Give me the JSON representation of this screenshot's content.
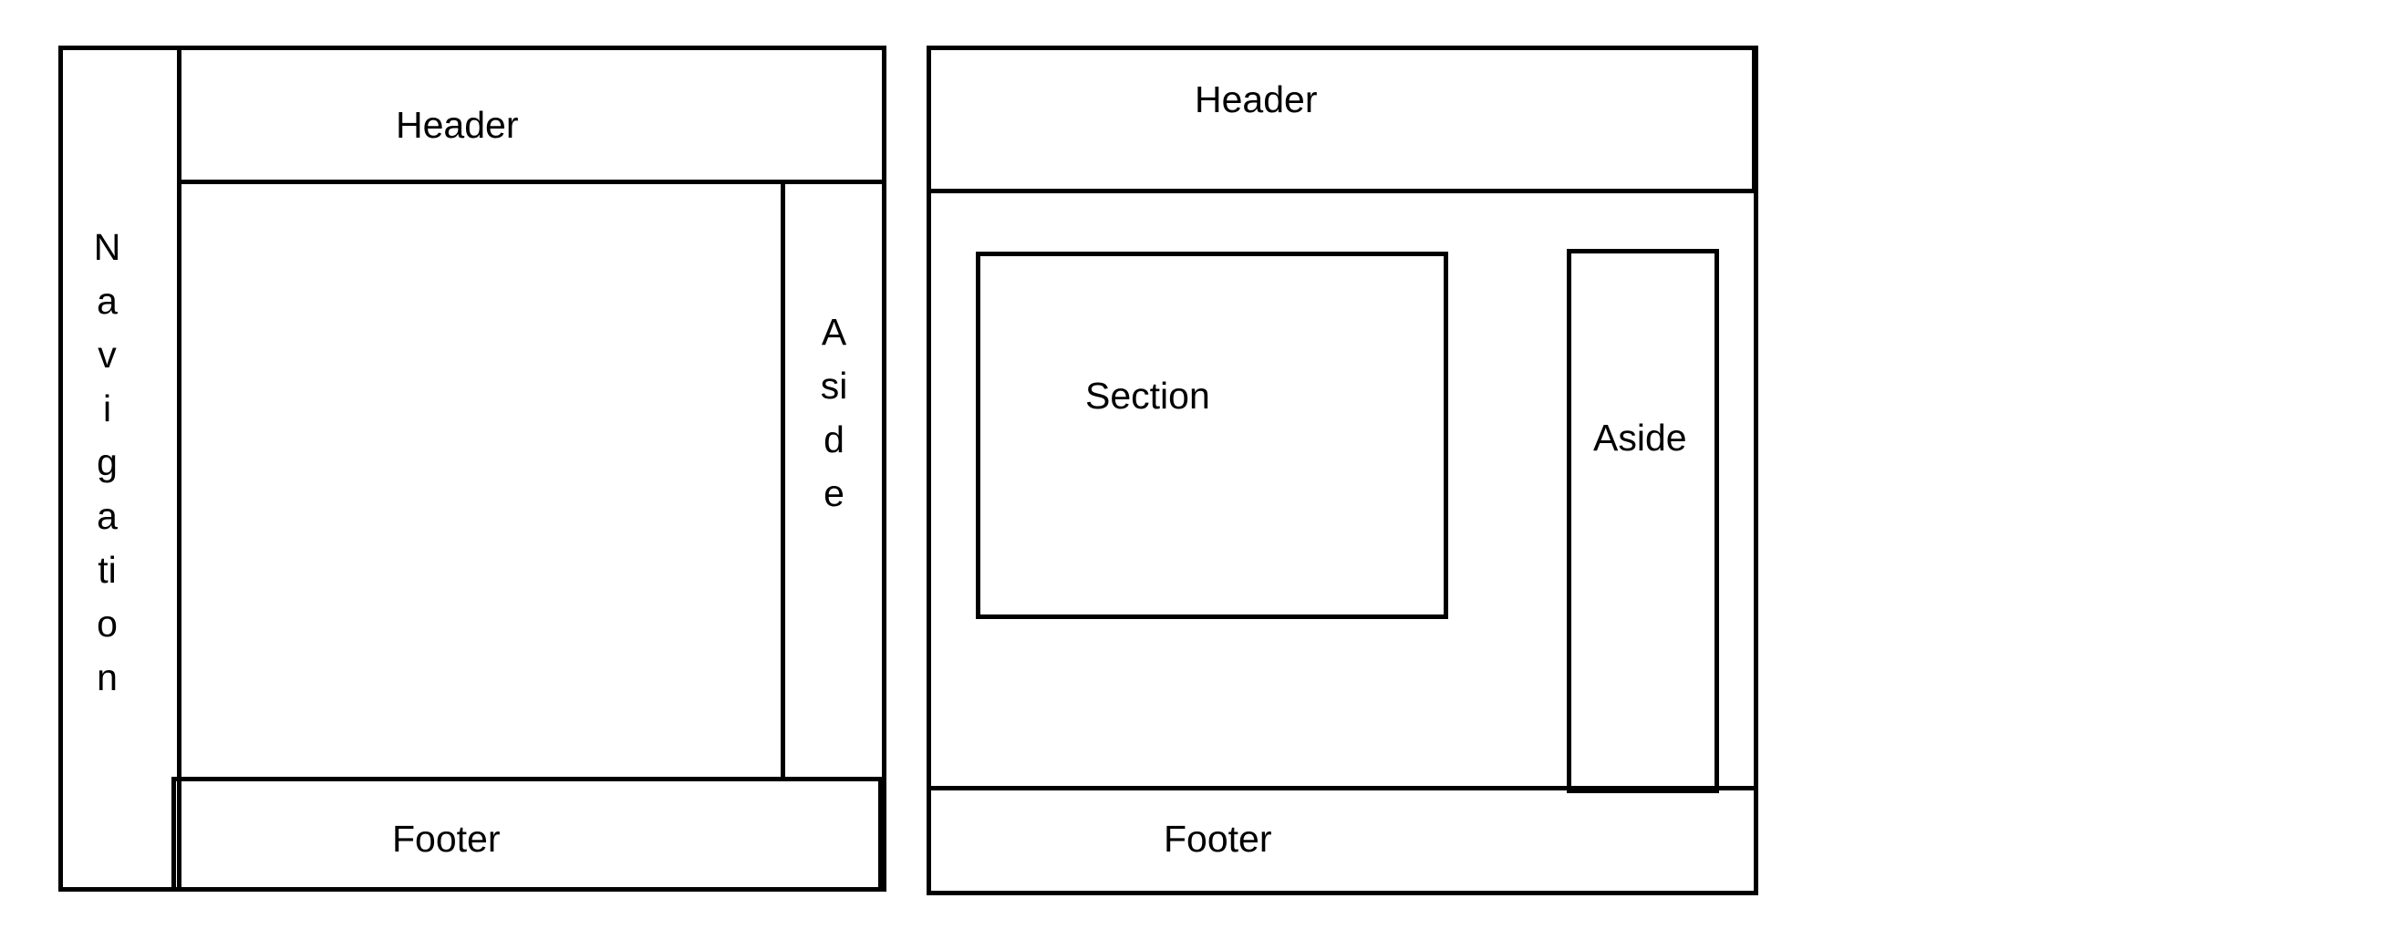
{
  "left_layout": {
    "header": "Header",
    "navigation_letters": [
      "N",
      "a",
      "v",
      "i",
      "g",
      "a",
      "ti",
      "o",
      "n"
    ],
    "aside_letters": [
      "A",
      "si",
      "d",
      "e"
    ],
    "footer": "Footer"
  },
  "right_layout": {
    "header": "Header",
    "section": "Section",
    "aside": "Aside",
    "footer": "Footer"
  }
}
